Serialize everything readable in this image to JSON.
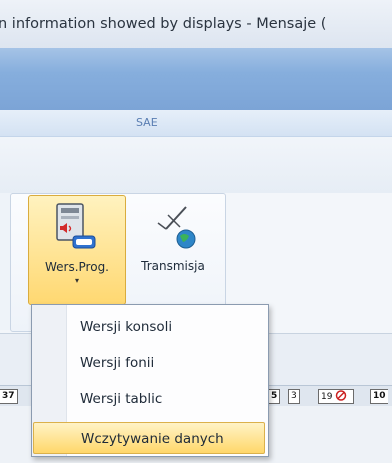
{
  "window": {
    "title": "n information showed by displays - Mensaje ("
  },
  "ribbon": {
    "context_tab": "SAE",
    "buttons": [
      {
        "label": "Wers.Prog.",
        "icon": "program-version-icon",
        "has_dropdown": true,
        "dropdown_glyph": "▾"
      },
      {
        "label": "Transmisja",
        "icon": "satellite-transmission-icon"
      }
    ]
  },
  "menu": {
    "items": [
      {
        "label": "Wersji konsoli"
      },
      {
        "label": "Wersji fonii"
      },
      {
        "label": "Wersji tablic"
      },
      {
        "label": "Wczytywanie danych",
        "highlighted": true
      }
    ]
  },
  "status_strip": {
    "left_value": "37",
    "cells": [
      "5",
      "3",
      "19",
      "10"
    ]
  },
  "colors": {
    "ribbon_blue": "#86aedd",
    "highlight": "#ffd76a"
  }
}
